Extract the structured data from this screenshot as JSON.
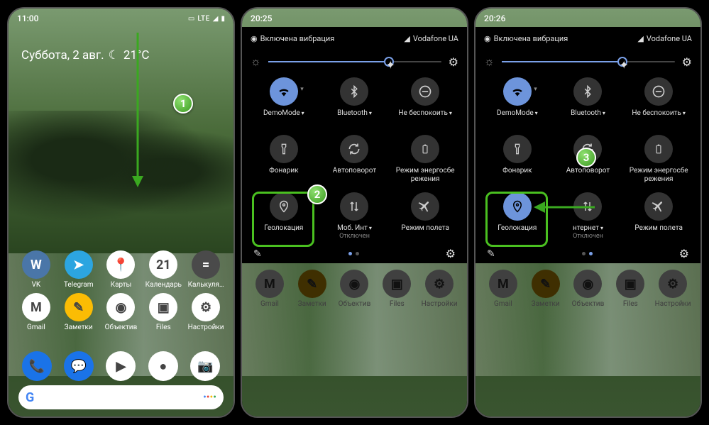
{
  "home": {
    "time": "11:00",
    "network": "LTE",
    "weather_date": "Суббота, 2 авг.",
    "weather_temp": "21°C",
    "apps_row1": [
      {
        "label": "VK",
        "bg": "#4a76a8",
        "glyph": "W"
      },
      {
        "label": "Telegram",
        "bg": "#2ca5e0",
        "glyph": "➤"
      },
      {
        "label": "Карты",
        "bg": "#fff",
        "glyph": "📍"
      },
      {
        "label": "Календарь",
        "bg": "#fff",
        "glyph": "21"
      },
      {
        "label": "Калькуля…",
        "bg": "#4a4a4a",
        "glyph": "="
      }
    ],
    "apps_row2": [
      {
        "label": "Gmail",
        "bg": "#fff",
        "glyph": "M"
      },
      {
        "label": "Заметки",
        "bg": "#fbbc04",
        "glyph": "✎"
      },
      {
        "label": "Объектив",
        "bg": "#fff",
        "glyph": "◉"
      },
      {
        "label": "Files",
        "bg": "#fff",
        "glyph": "▣"
      },
      {
        "label": "Настройки",
        "bg": "#fff",
        "glyph": "⚙"
      }
    ],
    "dock": [
      {
        "bg": "#1a73e8",
        "glyph": "📞"
      },
      {
        "bg": "#1a73e8",
        "glyph": "💬"
      },
      {
        "bg": "#fff",
        "glyph": "▶"
      },
      {
        "bg": "#fff",
        "glyph": "●"
      },
      {
        "bg": "#fff",
        "glyph": "📷"
      }
    ],
    "search_g": "G"
  },
  "qs": {
    "time2": "20:25",
    "time3": "20:26",
    "vibration": "Включена вибрация",
    "carrier": "Vodafone UA",
    "tiles": [
      {
        "label": "DemoMode",
        "dd": true,
        "icon": "wifi",
        "active": true
      },
      {
        "label": "Bluetooth",
        "dd": true,
        "icon": "bluetooth"
      },
      {
        "label": "Не беспокоить",
        "dd": true,
        "icon": "dnd"
      },
      {
        "label": "Фонарик",
        "icon": "flashlight"
      },
      {
        "label": "Автоповорот",
        "icon": "rotate"
      },
      {
        "label": "Режим энергосбе\nрежения",
        "icon": "battery"
      },
      {
        "label": "Геолокация",
        "icon": "location"
      },
      {
        "label": "Моб. Инт",
        "sub": "Отключен",
        "dd": true,
        "icon": "data"
      },
      {
        "label": "Режим полета",
        "icon": "airplane"
      }
    ],
    "tiles3_diff": {
      "label7": "нтернет",
      "sub7": "Отключен"
    }
  },
  "annotations": {
    "b1": "1",
    "b2": "2",
    "b3": "3"
  }
}
